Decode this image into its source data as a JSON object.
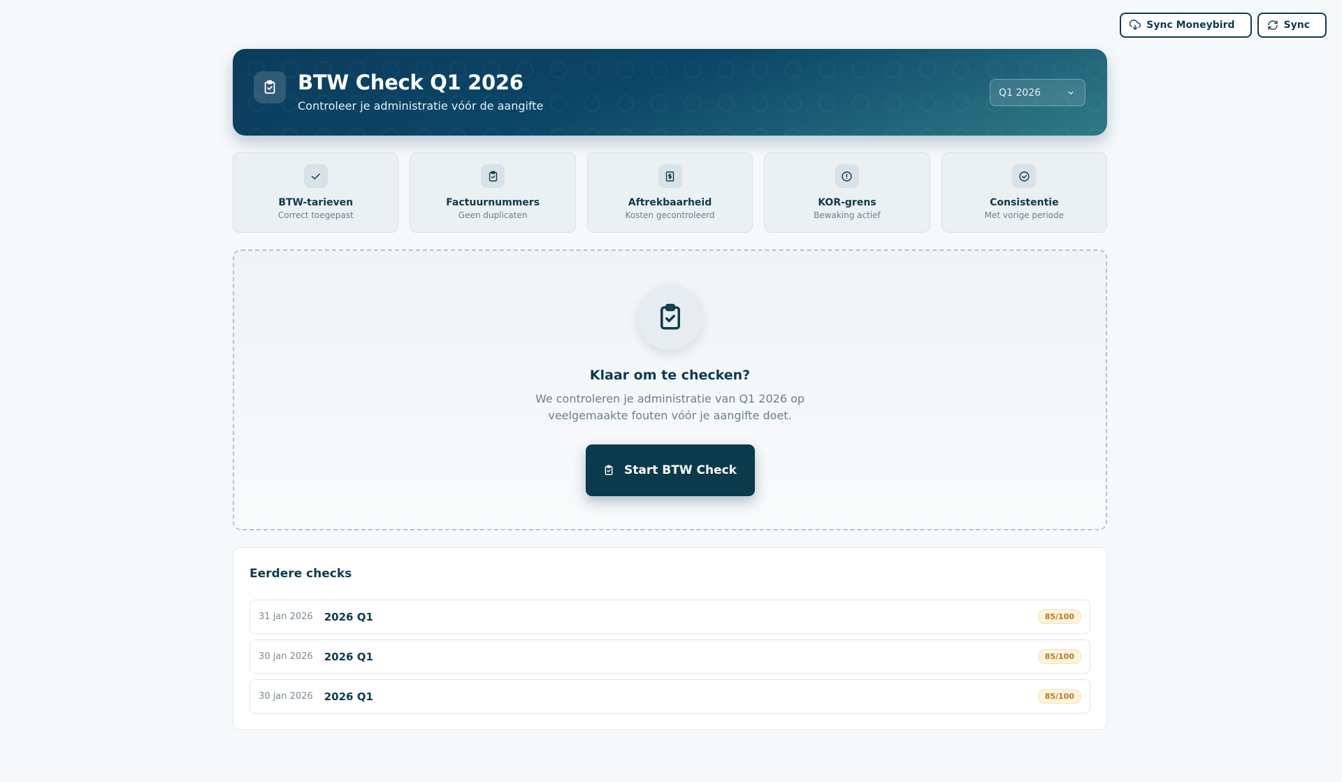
{
  "topbar": {
    "sync_moneybird_label": "Sync Moneybird",
    "sync_label": "Sync"
  },
  "hero": {
    "title": "BTW Check Q1 2026",
    "subtitle": "Controleer je administratie vóór de aangifte",
    "period_selected": "Q1 2026"
  },
  "features": [
    {
      "title": "BTW-tarieven",
      "subtitle": "Correct toegepast",
      "icon": "check-icon"
    },
    {
      "title": "Factuurnummers",
      "subtitle": "Geen duplicaten",
      "icon": "clipboard-check-icon"
    },
    {
      "title": "Aftrekbaarheid",
      "subtitle": "Kosten gecontroleerd",
      "icon": "receipt-icon"
    },
    {
      "title": "KOR-grens",
      "subtitle": "Bewaking actief",
      "icon": "alert-circle-icon"
    },
    {
      "title": "Consistentie",
      "subtitle": "Met vorige periode",
      "icon": "check-circle-icon"
    }
  ],
  "panel": {
    "title": "Klaar om te checken?",
    "description_line1": "We controleren je administratie van Q1 2026 op",
    "description_line2": "veelgemaakte fouten vóór je aangifte doet.",
    "start_label": "Start BTW Check"
  },
  "history": {
    "title": "Eerdere checks",
    "rows": [
      {
        "date": "31 jan 2026",
        "period": "2026 Q1",
        "score": "85/100"
      },
      {
        "date": "30 jan 2026",
        "period": "2026 Q1",
        "score": "85/100"
      },
      {
        "date": "30 jan 2026",
        "period": "2026 Q1",
        "score": "85/100"
      }
    ]
  },
  "colors": {
    "brand_dark": "#0c3a4d",
    "hero_gradient_start": "#0c3c5c",
    "hero_gradient_end": "#2f7a86",
    "score_text": "#b7791f",
    "score_bg": "#fdf4e0"
  }
}
